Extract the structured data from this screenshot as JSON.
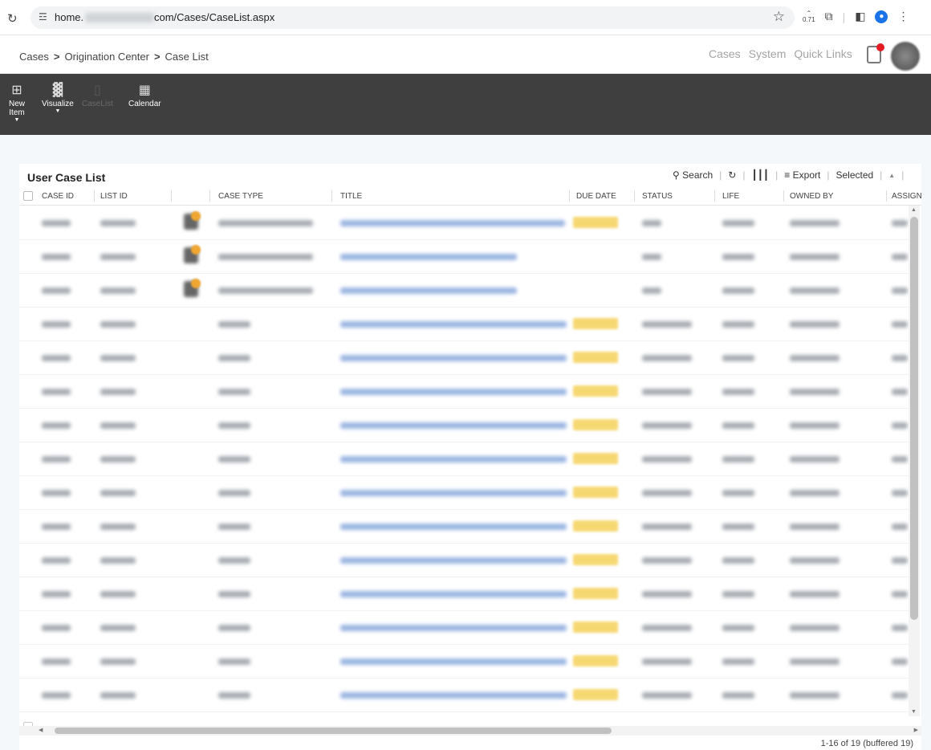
{
  "browser": {
    "url_prefix": "home.",
    "url_suffix": "com/Cases/CaseList.aspx",
    "zoom_label": "0.71"
  },
  "header": {
    "breadcrumb": [
      "Cases",
      "Origination Center",
      "Case List"
    ],
    "links": [
      "Cases",
      "System",
      "Quick Links"
    ],
    "notification_color": "#e51b23"
  },
  "toolbar": {
    "items": [
      {
        "label": "New Item",
        "icon": "plus-box-icon",
        "enabled": true
      },
      {
        "label": "Visualize",
        "icon": "bar-chart-icon",
        "enabled": true
      },
      {
        "label": "CaseList",
        "icon": "list-icon",
        "enabled": false
      },
      {
        "label": "Calendar",
        "icon": "calendar-icon",
        "enabled": true
      }
    ]
  },
  "panel": {
    "title": "User Case List",
    "tools": {
      "search": "Search",
      "export": "Export",
      "selected": "Selected"
    },
    "columns": [
      "CASE ID",
      "LIST ID",
      "CASE TYPE",
      "TITLE",
      "DUE DATE",
      "STATUS",
      "LIFE",
      "OWNED BY",
      "ASSIGN"
    ],
    "footer": "1-16 of 19 (buffered 19)"
  },
  "colors": {
    "toolbar_bg": "#3f3f3f",
    "due_highlight": "#f6d872",
    "link": "#4a78c8"
  }
}
